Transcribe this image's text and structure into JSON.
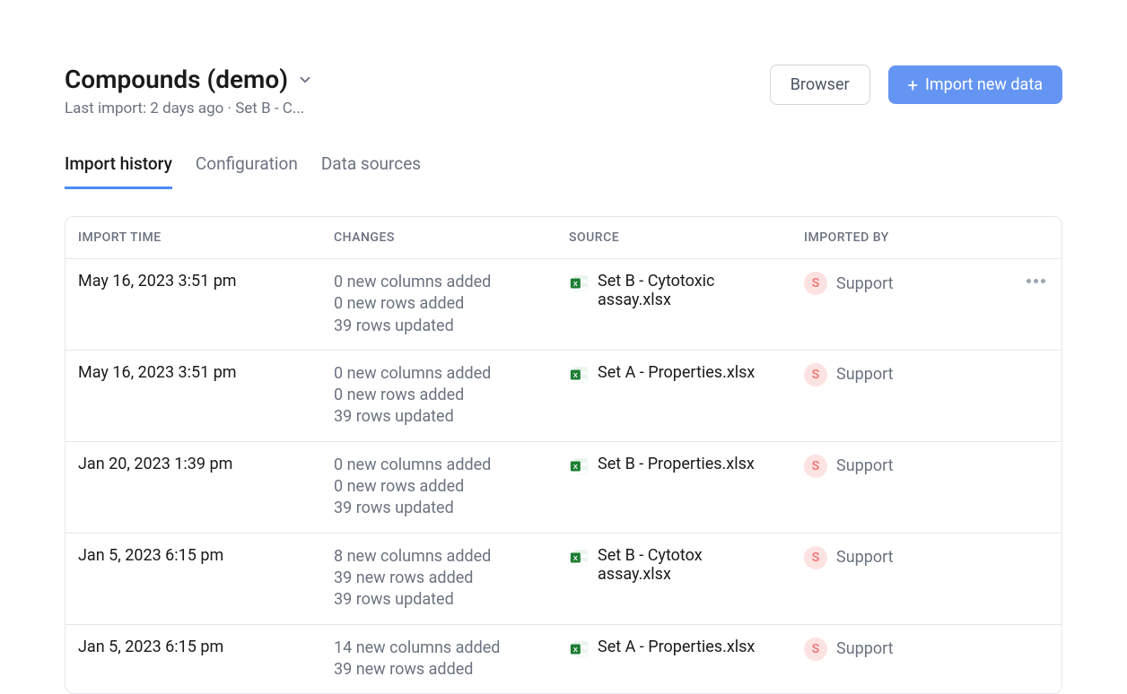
{
  "header": {
    "title": "Compounds (demo)",
    "subtitle": "Last import: 2 days ago · Set B - C...",
    "browser_button": "Browser",
    "import_button": "Import new data"
  },
  "tabs": [
    {
      "label": "Import history",
      "active": true
    },
    {
      "label": "Configuration",
      "active": false
    },
    {
      "label": "Data sources",
      "active": false
    }
  ],
  "table": {
    "headers": {
      "time": "IMPORT TIME",
      "changes": "CHANGES",
      "source": "SOURCE",
      "imported_by": "IMPORTED BY"
    },
    "rows": [
      {
        "time": "May 16, 2023 3:51 pm",
        "changes": [
          "0 new columns added",
          "0 new rows added",
          "39 rows updated"
        ],
        "source": "Set B - Cytotoxic assay.xlsx",
        "user_initial": "S",
        "user_name": "Support",
        "show_more": true
      },
      {
        "time": "May 16, 2023 3:51 pm",
        "changes": [
          "0 new columns added",
          "0 new rows added",
          "39 rows updated"
        ],
        "source": "Set A - Properties.xlsx",
        "user_initial": "S",
        "user_name": "Support",
        "show_more": false
      },
      {
        "time": "Jan 20, 2023 1:39 pm",
        "changes": [
          "0 new columns added",
          "0 new rows added",
          "39 rows updated"
        ],
        "source": "Set B - Properties.xlsx",
        "user_initial": "S",
        "user_name": "Support",
        "show_more": false
      },
      {
        "time": "Jan 5, 2023 6:15 pm",
        "changes": [
          "8 new columns added",
          "39 new rows added",
          "39 rows updated"
        ],
        "source": "Set B - Cytotox assay.xlsx",
        "user_initial": "S",
        "user_name": "Support",
        "show_more": false
      },
      {
        "time": "Jan 5, 2023 6:15 pm",
        "changes": [
          "14 new columns added",
          "39 new rows added"
        ],
        "source": "Set A - Properties.xlsx",
        "user_initial": "S",
        "user_name": "Support",
        "show_more": false
      }
    ]
  }
}
